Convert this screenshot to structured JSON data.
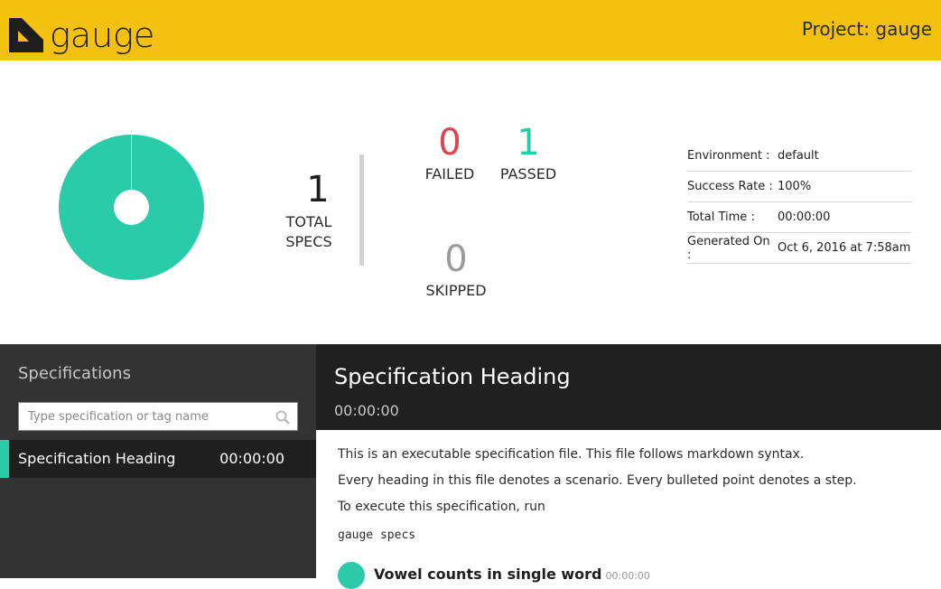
{
  "header": {
    "logo_text": "gauge",
    "project_title": "Project: gauge"
  },
  "summary": {
    "total": "1",
    "total_label_line1": "TOTAL",
    "total_label_line2": "SPECS",
    "failed": "0",
    "failed_label": "FAILED",
    "passed": "1",
    "passed_label": "PASSED",
    "skipped": "0",
    "skipped_label": "SKIPPED",
    "pass_fraction": 1.0,
    "colors": {
      "passed": "#29cba8",
      "failed": "#e0434e",
      "skipped": "#9b9b9b"
    }
  },
  "environment": [
    {
      "key": "Environment :",
      "value": "default"
    },
    {
      "key": "Success Rate :",
      "value": "100%"
    },
    {
      "key": "Total Time :",
      "value": "00:00:00"
    },
    {
      "key": "Generated On :",
      "value": "Oct 6, 2016 at 7:58am"
    }
  ],
  "sidebar": {
    "title": "Specifications",
    "search_placeholder": "Type specification or tag name",
    "items": [
      {
        "name": "Specification Heading",
        "time": "00:00:00",
        "status": "passed"
      }
    ]
  },
  "spec": {
    "title": "Specification Heading",
    "time": "00:00:00",
    "paragraphs": [
      "This is an executable specification file. This file follows markdown syntax.",
      "Every heading in this file denotes a scenario. Every bulleted point denotes a step.",
      "To execute this specification, run"
    ],
    "code": "gauge  specs",
    "scenario": {
      "title": "Vowel counts in single word",
      "time": "00:00:00"
    }
  },
  "icons": {
    "logo": "gauge-logo-icon",
    "search": "search-icon"
  }
}
